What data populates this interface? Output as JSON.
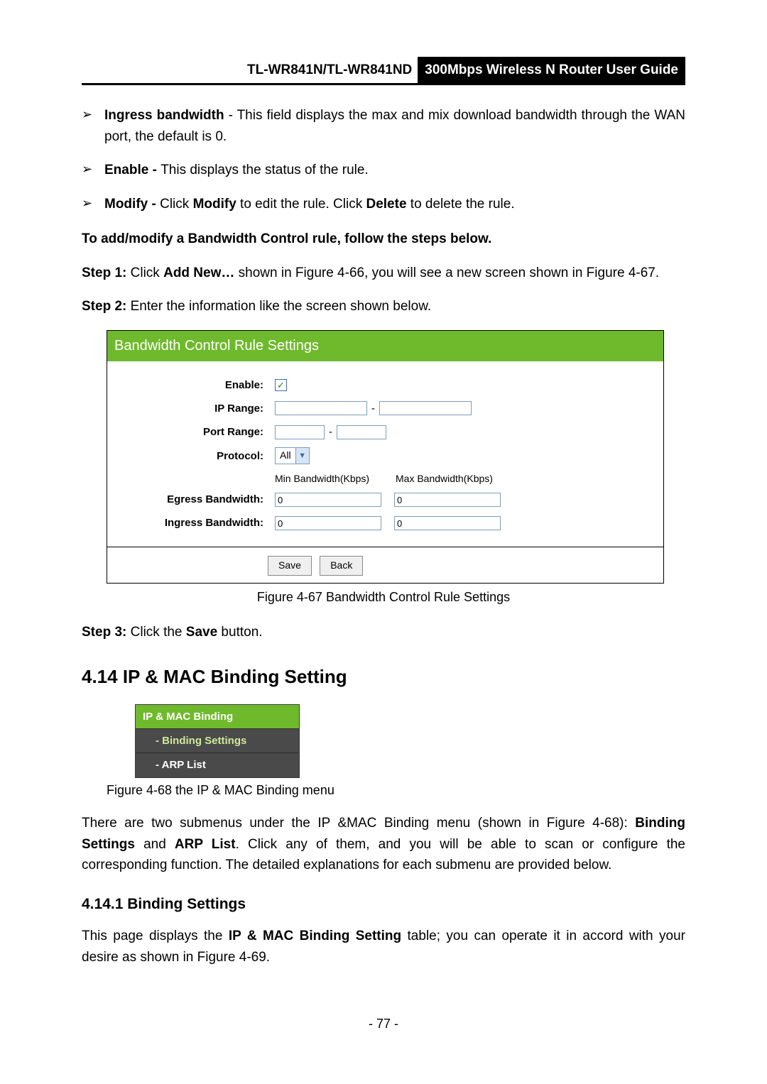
{
  "header": {
    "left": "TL-WR841N/TL-WR841ND",
    "right": "300Mbps Wireless N Router User Guide"
  },
  "bullets": {
    "ingress_label": "Ingress bandwidth",
    "ingress_text": " - This field displays the max and mix download bandwidth through the WAN port, the default is 0.",
    "enable_label": "Enable - ",
    "enable_text": "This displays the status of the rule.",
    "modify_label": "Modify - ",
    "modify_t1": "Click ",
    "modify_b1": "Modify",
    "modify_t2": " to edit the rule. Click ",
    "modify_b2": "Delete",
    "modify_t3": " to delete the rule."
  },
  "intro": "To add/modify a Bandwidth Control rule, follow the steps below.",
  "step1": {
    "label": "Step 1:",
    "t1": "  Click ",
    "b1": "Add New…",
    "t2": " shown in Figure 4-66, you will see a new screen shown in Figure 4-67."
  },
  "step2": {
    "label": "Step 2:",
    "text": "  Enter the information like the screen shown below."
  },
  "panel": {
    "title": "Bandwidth Control Rule Settings",
    "labels": {
      "enable": "Enable:",
      "iprange": "IP Range:",
      "portrange": "Port Range:",
      "protocol": "Protocol:",
      "egress": "Egress Bandwidth:",
      "ingress": "Ingress Bandwidth:"
    },
    "protocol_value": "All",
    "col_min": "Min Bandwidth(Kbps)",
    "col_max": "Max Bandwidth(Kbps)",
    "egress_min": "0",
    "egress_max": "0",
    "ingress_min": "0",
    "ingress_max": "0",
    "save": "Save",
    "back": "Back",
    "dash": "-",
    "check": "✓"
  },
  "cap67": "Figure 4-67 Bandwidth Control Rule Settings",
  "step3": {
    "label": "Step 3:",
    "t1": "  Click the ",
    "b1": "Save",
    "t2": " button."
  },
  "sec414": "4.14 IP & MAC Binding Setting",
  "menu": {
    "head": "IP & MAC Binding",
    "i1": "- Binding Settings",
    "i2": "- ARP List"
  },
  "cap68": "Figure 4-68 the IP & MAC Binding menu",
  "para414": {
    "t1": "There are two submenus under the IP &MAC Binding menu (shown in Figure 4-68): ",
    "b1": "Binding Settings",
    "t2": " and ",
    "b2": "ARP List",
    "t3": ". Click any of them, and you will be able to scan or configure the corresponding function. The detailed explanations for each submenu are provided below."
  },
  "sub4141": "4.14.1 Binding Settings",
  "para4141": {
    "t1": "This page displays the ",
    "b1": "IP & MAC Binding Setting",
    "t2": " table; you can operate it in accord with your desire as shown in Figure 4-69."
  },
  "pageno": "- 77 -"
}
